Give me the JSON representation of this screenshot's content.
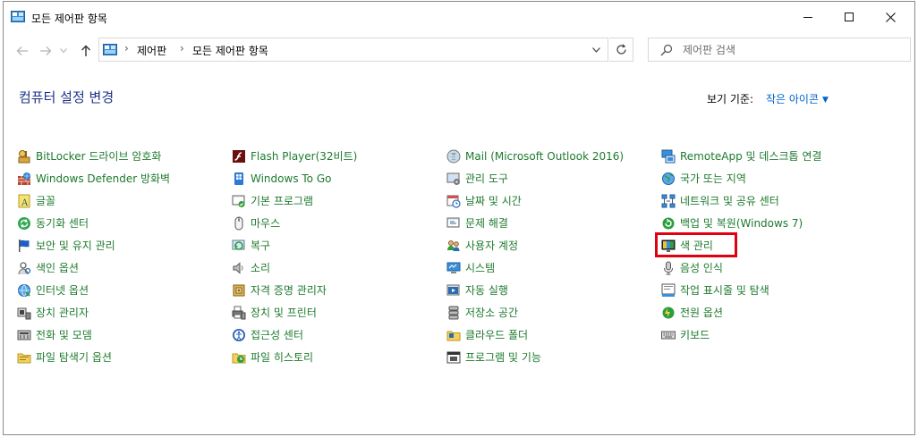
{
  "window": {
    "title": "모든 제어판 항목",
    "minimize_glyph": "—",
    "maximize_glyph": "☐",
    "close_glyph": "✕"
  },
  "address": {
    "crumbs": [
      "제어판",
      "모든 제어판 항목"
    ]
  },
  "search": {
    "placeholder": "제어판 검색"
  },
  "header": {
    "title": "컴퓨터 설정 변경",
    "view_by_label": "보기 기준:",
    "view_by_value": "작은 아이콘"
  },
  "columns": [
    [
      {
        "label": "BitLocker 드라이브 암호화",
        "icon": "key-icon"
      },
      {
        "label": "Windows Defender 방화벽",
        "icon": "firewall-icon"
      },
      {
        "label": "글꼴",
        "icon": "font-icon"
      },
      {
        "label": "동기화 센터",
        "icon": "sync-icon"
      },
      {
        "label": "보안 및 유지 관리",
        "icon": "flag-icon"
      },
      {
        "label": "색인 옵션",
        "icon": "indexing-icon"
      },
      {
        "label": "인터넷 옵션",
        "icon": "internet-icon"
      },
      {
        "label": "장치 관리자",
        "icon": "device-manager-icon"
      },
      {
        "label": "전화 및 모뎀",
        "icon": "phone-icon"
      },
      {
        "label": "파일 탐색기 옵션",
        "icon": "folder-options-icon"
      }
    ],
    [
      {
        "label": "Flash Player(32비트)",
        "icon": "flash-icon"
      },
      {
        "label": "Windows To Go",
        "icon": "windows-to-go-icon"
      },
      {
        "label": "기본 프로그램",
        "icon": "default-programs-icon"
      },
      {
        "label": "마우스",
        "icon": "mouse-icon"
      },
      {
        "label": "복구",
        "icon": "recovery-icon"
      },
      {
        "label": "소리",
        "icon": "speaker-icon"
      },
      {
        "label": "자격 증명 관리자",
        "icon": "credential-icon"
      },
      {
        "label": "장치 및 프린터",
        "icon": "printer-icon"
      },
      {
        "label": "접근성 센터",
        "icon": "accessibility-icon"
      },
      {
        "label": "파일 히스토리",
        "icon": "file-history-icon"
      }
    ],
    [
      {
        "label": "Mail (Microsoft Outlook 2016)",
        "icon": "mail-icon"
      },
      {
        "label": "관리 도구",
        "icon": "admin-tools-icon"
      },
      {
        "label": "날짜 및 시간",
        "icon": "clock-icon"
      },
      {
        "label": "문제 해결",
        "icon": "troubleshoot-icon"
      },
      {
        "label": "사용자 계정",
        "icon": "users-icon"
      },
      {
        "label": "시스템",
        "icon": "system-icon"
      },
      {
        "label": "자동 실행",
        "icon": "autoplay-icon"
      },
      {
        "label": "저장소 공간",
        "icon": "storage-icon"
      },
      {
        "label": "클라우드 폴더",
        "icon": "cloud-folder-icon"
      },
      {
        "label": "프로그램 및 기능",
        "icon": "programs-icon"
      }
    ],
    [
      {
        "label": "RemoteApp 및 데스크톱 연결",
        "icon": "remoteapp-icon"
      },
      {
        "label": "국가 또는 지역",
        "icon": "globe-icon"
      },
      {
        "label": "네트워크 및 공유 센터",
        "icon": "network-icon"
      },
      {
        "label": "백업 및 복원(Windows 7)",
        "icon": "backup-icon"
      },
      {
        "label": "색 관리",
        "icon": "color-management-icon"
      },
      {
        "label": "음성 인식",
        "icon": "microphone-icon"
      },
      {
        "label": "작업 표시줄 및 탐색",
        "icon": "taskbar-icon"
      },
      {
        "label": "전원 옵션",
        "icon": "power-icon"
      },
      {
        "label": "키보드",
        "icon": "keyboard-icon"
      }
    ]
  ],
  "colors": {
    "link_green": "#1e7a2e",
    "title_blue": "#1e3287",
    "accent_blue": "#0066cc",
    "highlight_red": "#e00010"
  }
}
